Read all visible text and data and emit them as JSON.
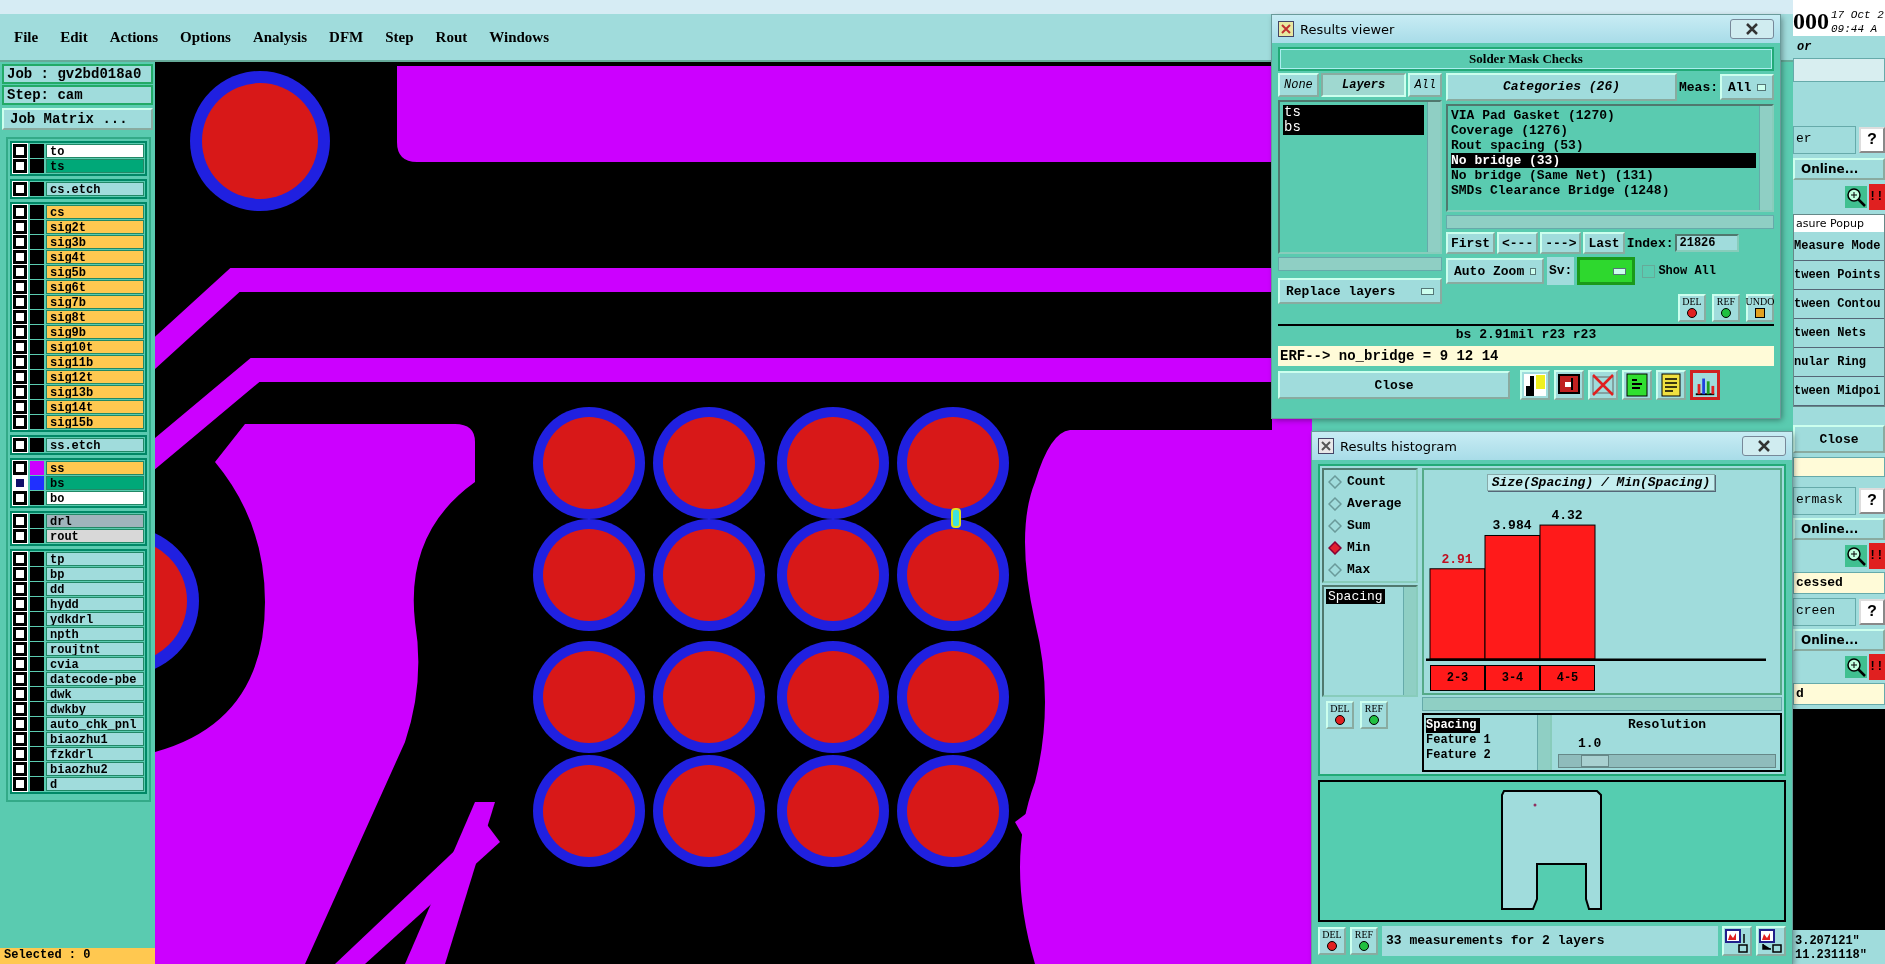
{
  "menu": [
    "File",
    "Edit",
    "Actions",
    "Options",
    "Analysis",
    "DFM",
    "Step",
    "Rout",
    "Windows"
  ],
  "job_panel": {
    "job": "Job : gv2bd018a0",
    "step": "Step: cam",
    "matrix_button": "Job Matrix ...",
    "status": "Selected : 0",
    "groups": [
      [
        {
          "name": "to",
          "kind": "paste",
          "checked": false
        },
        {
          "name": "ts",
          "kind": "solder_mask",
          "checked": false
        }
      ],
      [
        {
          "name": "cs.etch",
          "kind": "etch",
          "checked": false
        }
      ],
      [
        {
          "name": "cs",
          "kind": "signal",
          "checked": false
        },
        {
          "name": "sig2t",
          "kind": "signal",
          "checked": false
        },
        {
          "name": "sig3b",
          "kind": "signal",
          "checked": false
        },
        {
          "name": "sig4t",
          "kind": "signal",
          "checked": false
        },
        {
          "name": "sig5b",
          "kind": "signal",
          "checked": false
        },
        {
          "name": "sig6t",
          "kind": "signal",
          "checked": false
        },
        {
          "name": "sig7b",
          "kind": "signal",
          "checked": false
        },
        {
          "name": "sig8t",
          "kind": "signal",
          "checked": false
        },
        {
          "name": "sig9b",
          "kind": "signal",
          "checked": false
        },
        {
          "name": "sig10t",
          "kind": "signal",
          "checked": false
        },
        {
          "name": "sig11b",
          "kind": "signal",
          "checked": false
        },
        {
          "name": "sig12t",
          "kind": "signal",
          "checked": false
        },
        {
          "name": "sig13b",
          "kind": "signal",
          "checked": false
        },
        {
          "name": "sig14t",
          "kind": "signal",
          "checked": false
        },
        {
          "name": "sig15b",
          "kind": "signal",
          "checked": false
        }
      ],
      [
        {
          "name": "ss.etch",
          "kind": "etch",
          "checked": false
        }
      ],
      [
        {
          "name": "ss",
          "kind": "silk_screen",
          "checked": false,
          "color": "#cc00ff"
        },
        {
          "name": "bs",
          "kind": "solder_mask",
          "checked": true,
          "color": "#2030ff"
        },
        {
          "name": "bo",
          "kind": "paste",
          "checked": false
        }
      ],
      [
        {
          "name": "drl",
          "kind": "drill",
          "checked": false
        },
        {
          "name": "rout",
          "kind": "rout",
          "checked": false
        }
      ],
      [
        {
          "name": "tp",
          "kind": "misc",
          "checked": false
        },
        {
          "name": "bp",
          "kind": "misc",
          "checked": false
        },
        {
          "name": "dd",
          "kind": "misc",
          "checked": false
        },
        {
          "name": "hydd",
          "kind": "misc",
          "checked": false
        },
        {
          "name": "ydkdrl",
          "kind": "misc",
          "checked": false
        },
        {
          "name": "npth",
          "kind": "misc",
          "checked": false
        },
        {
          "name": "roujtnt",
          "kind": "misc",
          "checked": false
        },
        {
          "name": "cvia",
          "kind": "misc",
          "checked": false
        },
        {
          "name": "datecode-pbe",
          "kind": "misc",
          "checked": false
        },
        {
          "name": "dwk",
          "kind": "misc",
          "checked": false
        },
        {
          "name": "dwkby",
          "kind": "misc",
          "checked": false
        },
        {
          "name": "auto_chk_pnl",
          "kind": "misc",
          "checked": false
        },
        {
          "name": "biaozhu1",
          "kind": "misc",
          "checked": false
        },
        {
          "name": "fzkdrl",
          "kind": "misc",
          "checked": false
        },
        {
          "name": "biaozhu2",
          "kind": "misc",
          "checked": false
        },
        {
          "name": "d",
          "kind": "misc",
          "checked": false
        }
      ]
    ]
  },
  "results_viewer": {
    "title": "Results viewer",
    "heading": "Solder Mask Checks",
    "layer_tabs": [
      {
        "label": "None",
        "selected": false
      },
      {
        "label": "Layers",
        "selected": true
      },
      {
        "label": "All",
        "selected": false
      }
    ],
    "layers": [
      {
        "name": "ts",
        "selected": true
      },
      {
        "name": "bs",
        "selected": true
      }
    ],
    "replace_button": "Replace layers",
    "categories_header": "Categories (26)",
    "meas_label": "Meas:",
    "meas_value": "All",
    "categories": [
      {
        "label": "VIA Pad Gasket (1270)",
        "selected": false
      },
      {
        "label": "Coverage (1276)",
        "selected": false
      },
      {
        "label": "Rout spacing (53)",
        "selected": false
      },
      {
        "label": "No bridge (33)",
        "selected": true
      },
      {
        "label": "No bridge (Same Net) (131)",
        "selected": false
      },
      {
        "label": "SMDs Clearance Bridge (1248)",
        "selected": false
      }
    ],
    "nav_buttons": [
      "First",
      "<---",
      "--->",
      "Last"
    ],
    "index_label": "Index:",
    "index_value": "21826",
    "zoom_value": "Auto Zoom",
    "sv_label": "Sv:",
    "show_all": {
      "label": "Show All",
      "checked": false
    },
    "action_buttons": [
      "DEL",
      "REF",
      "UNDO"
    ],
    "measurement": "bs 2.91mil  r23  r23",
    "erf": "ERF--> no_bridge = 9 12 14",
    "close": "Close"
  },
  "results_histogram": {
    "title": "Results histogram",
    "modes": [
      {
        "label": "Count",
        "selected": false
      },
      {
        "label": "Average",
        "selected": false
      },
      {
        "label": "Sum",
        "selected": false
      },
      {
        "label": "Min",
        "selected": true
      },
      {
        "label": "Max",
        "selected": false
      }
    ],
    "measures": [
      {
        "label": "Spacing",
        "selected": true
      }
    ],
    "chart_data": {
      "type": "bar",
      "title": "Size(Spacing) / Min(Spacing)",
      "categories": [
        "2-3",
        "3-4",
        "4-5"
      ],
      "values": [
        2.91,
        3.984,
        4.32
      ],
      "data_labels": true
    },
    "fields": [
      {
        "label": "Spacing",
        "selected": true
      },
      {
        "label": "Feature 1",
        "selected": false
      },
      {
        "label": "Feature 2",
        "selected": false
      }
    ],
    "resolution_label": "Resolution",
    "resolution_value": "1.0",
    "resolution_slider": {
      "level": 0.1
    },
    "side_buttons": [
      "DEL",
      "REF"
    ],
    "status_buttons": [
      "DEL",
      "REF"
    ],
    "status": "33 measurements for 2 layers"
  },
  "background_window": {
    "brand": "000",
    "date": "17 Oct 2",
    "time": "09:44 A",
    "subtitle": "or",
    "top_check": {
      "label": "er",
      "help": "?",
      "online": "Online...",
      "alert": "!!"
    },
    "popup_title": "asure Popup",
    "popup_items": [
      "Measure Mode",
      "tween Points",
      "tween Contou",
      "tween Nets",
      "nular Ring",
      "tween Midpoi"
    ],
    "close": "Close",
    "checks": [
      {
        "label": "ermask",
        "help": "?",
        "online": "Online...",
        "alert": "!!",
        "result": "cessed"
      },
      {
        "label": "creen",
        "help": "?",
        "online": "Online...",
        "alert": "!!",
        "result": "d"
      }
    ],
    "coords": [
      "3.207121\"",
      "11.231118\""
    ]
  }
}
